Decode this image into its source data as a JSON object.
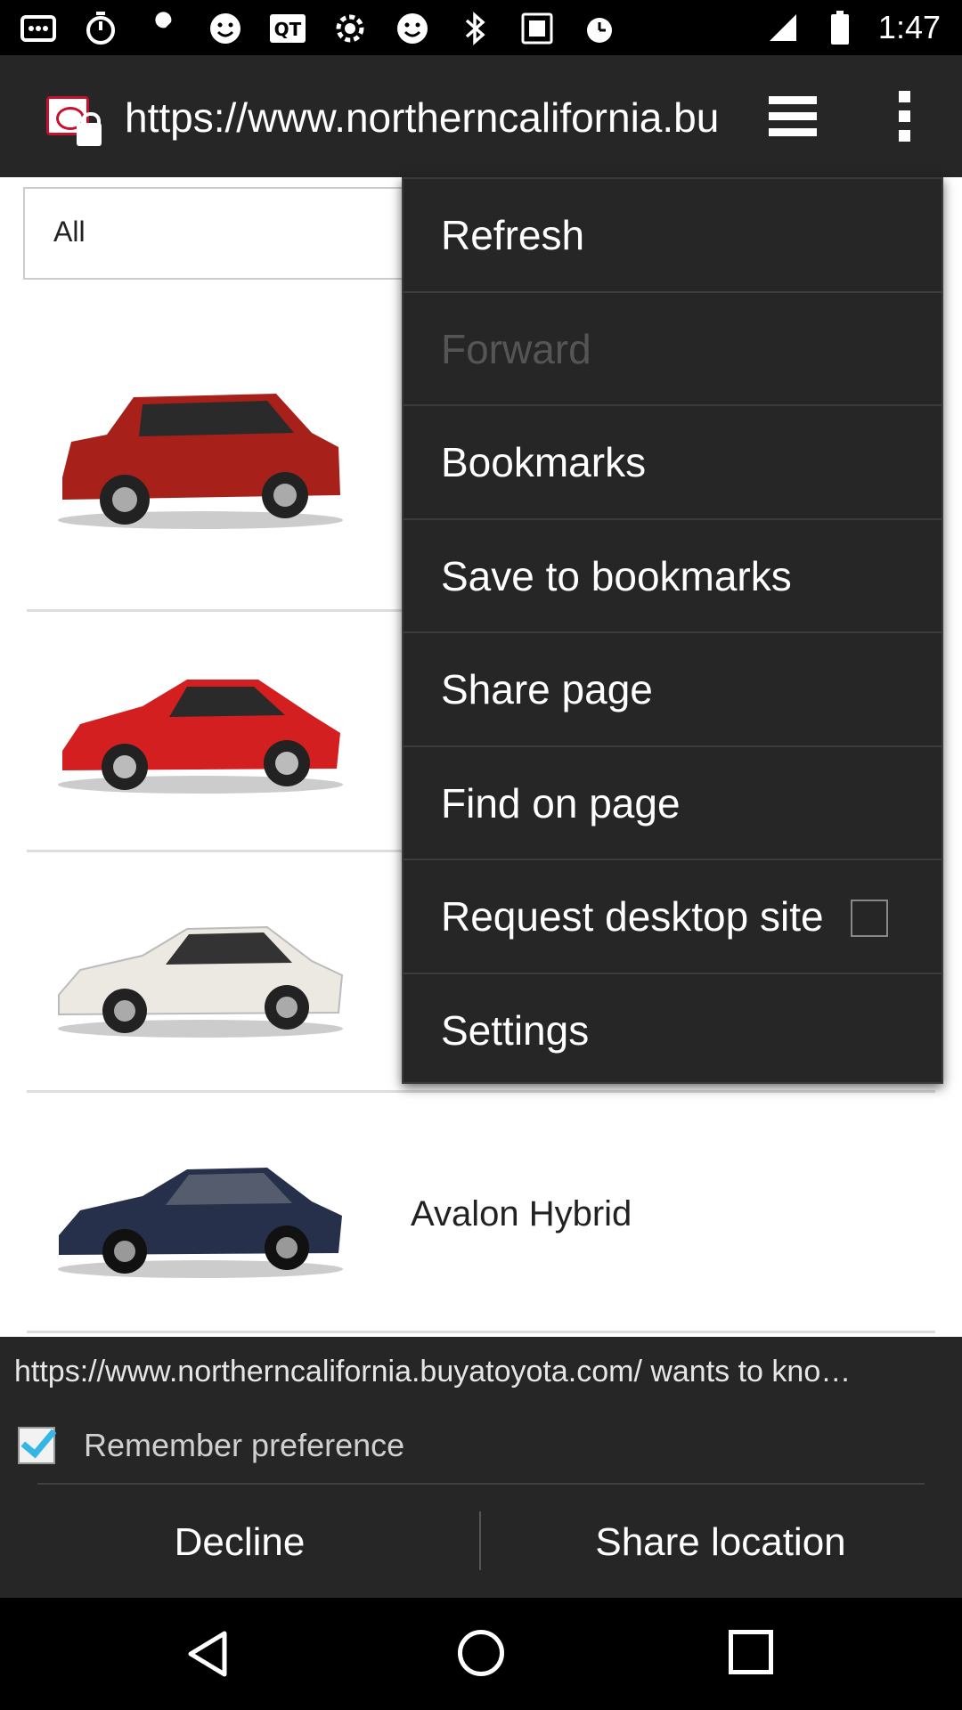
{
  "status_bar": {
    "time": "1:47",
    "left_icons": [
      "messages-icon",
      "timer-icon",
      "wrench-icon",
      "smiley-icon",
      "qt-icon",
      "settings-app-icon",
      "smiley-icon",
      "bluetooth-icon",
      "screenshot-icon",
      "alarm-icon"
    ],
    "right_icons": [
      "signal-icon",
      "battery-icon"
    ]
  },
  "browser": {
    "url": "https://www.northerncalifornia.buyatoyota.com/",
    "site_icon": "toyota-logo-lock-icon"
  },
  "page": {
    "filter_value": "All",
    "cars": [
      {
        "name": "",
        "color": "#a8201a"
      },
      {
        "name": "",
        "color": "#d31f1f"
      },
      {
        "name": "",
        "color": "#ebe9e2"
      },
      {
        "name": "Avalon Hybrid",
        "color": "#26304a"
      }
    ]
  },
  "menu": {
    "items": [
      {
        "label": "Refresh",
        "enabled": true
      },
      {
        "label": "Forward",
        "enabled": false
      },
      {
        "label": "Bookmarks",
        "enabled": true
      },
      {
        "label": "Save to bookmarks",
        "enabled": true
      },
      {
        "label": "Share page",
        "enabled": true
      },
      {
        "label": "Find on page",
        "enabled": true
      },
      {
        "label": "Request desktop site",
        "enabled": true,
        "checked": false
      },
      {
        "label": "Settings",
        "enabled": true
      }
    ]
  },
  "permission": {
    "message": "https://www.northerncalifornia.buyatoyota.com/ wants to kno…",
    "remember_label": "Remember preference",
    "remember_checked": true,
    "decline_label": "Decline",
    "share_label": "Share location"
  },
  "colors": {
    "toolbar_bg": "#262626",
    "menu_bg": "#262626",
    "check_accent": "#33b5e5"
  }
}
